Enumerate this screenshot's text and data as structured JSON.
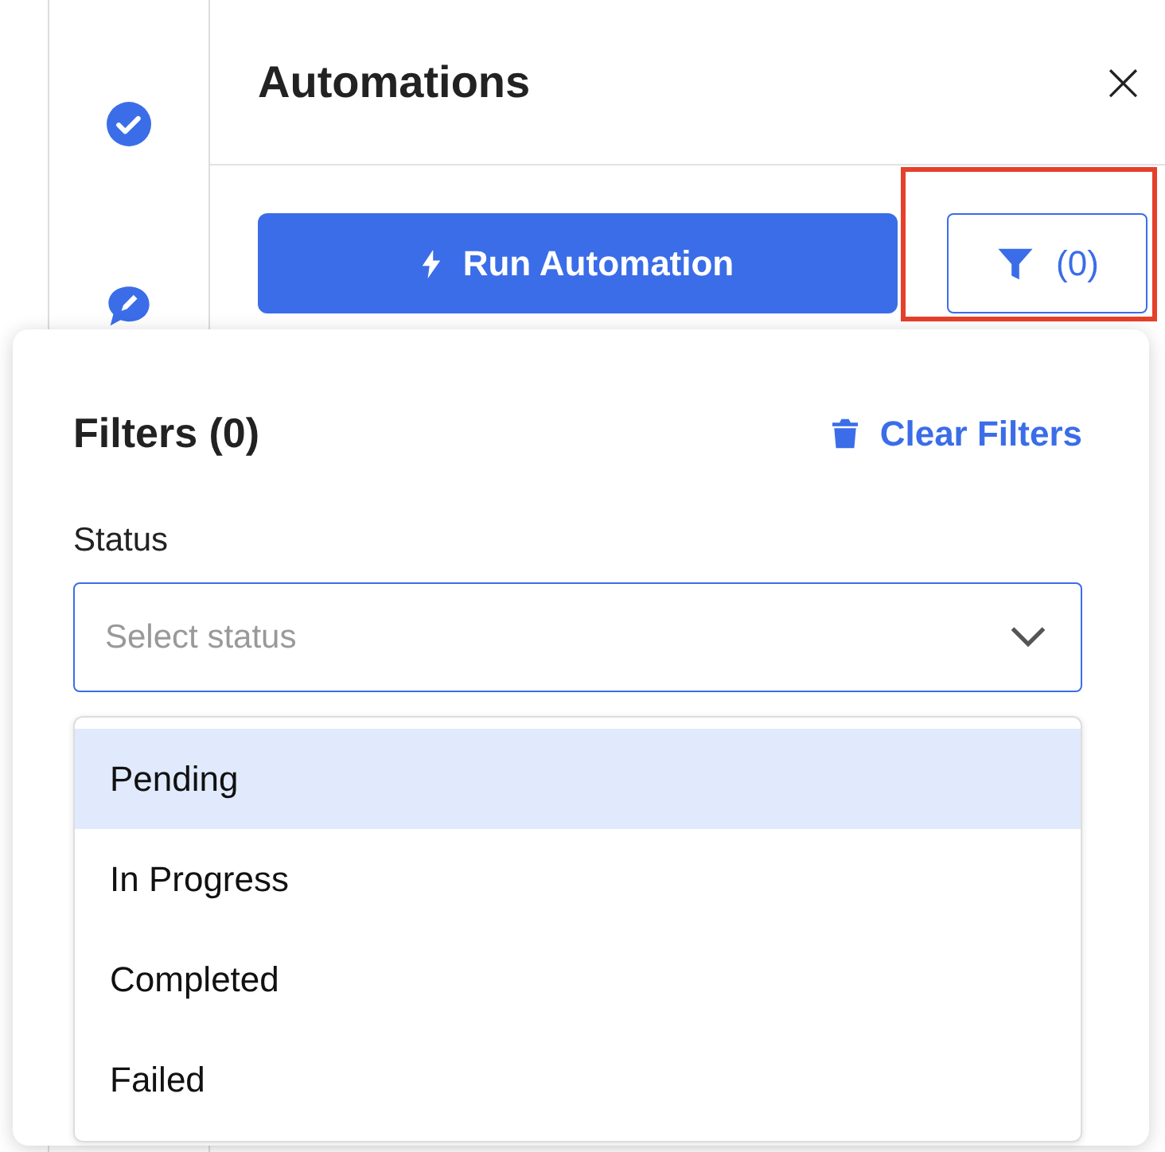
{
  "sidebar": {
    "items": [
      {
        "kind": "check"
      },
      {
        "kind": "chat"
      }
    ]
  },
  "panel": {
    "title": "Automations",
    "close": "×",
    "run_button": "Run Automation",
    "filter_button": {
      "label": "(0)",
      "highlighted": true
    }
  },
  "filters": {
    "title": "Filters (0)",
    "clear": "Clear Filters",
    "status_label": "Status",
    "select": {
      "placeholder": "Select status",
      "expanded": true
    },
    "options": [
      {
        "label": "Pending",
        "selected": true
      },
      {
        "label": "In Progress",
        "selected": false
      },
      {
        "label": "Completed",
        "selected": false
      },
      {
        "label": "Failed",
        "selected": false
      }
    ]
  }
}
